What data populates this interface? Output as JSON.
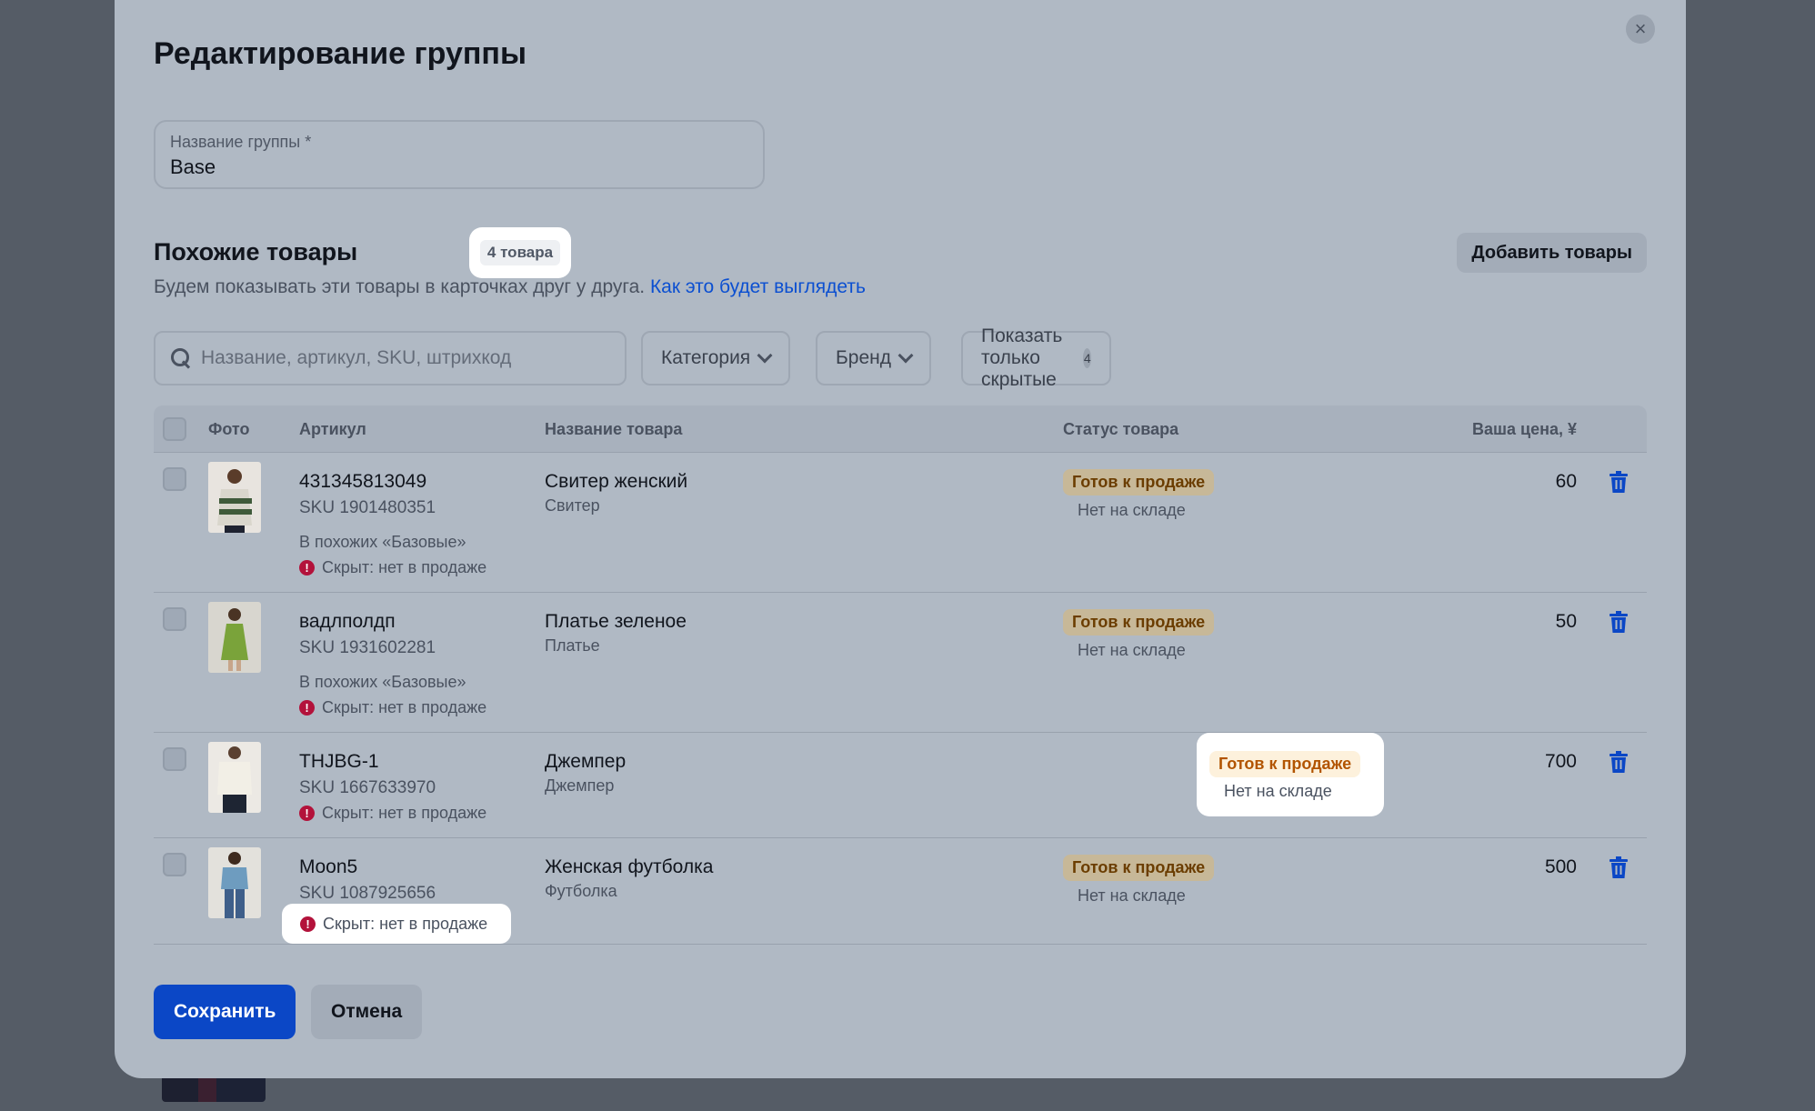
{
  "modal": {
    "title": "Редактирование группы",
    "close_icon": "close-icon",
    "name_field": {
      "label": "Название группы *",
      "value": "Base"
    },
    "similar": {
      "title": "Похожие товары",
      "count_badge": "4 товара",
      "description": "Будем показывать эти товары в карточках друг у друга.",
      "link": "Как это будет выглядеть",
      "add_button": "Добавить товары"
    },
    "filters": {
      "search_placeholder": "Название, артикул, SKU, штрихкод",
      "category": "Категория",
      "brand": "Бренд",
      "hidden_only": "Показать только скрытые",
      "hidden_count": "4"
    },
    "table": {
      "headers": {
        "photo": "Фото",
        "article": "Артикул",
        "name": "Название товара",
        "status": "Статус товара",
        "price": "Ваша цена, ¥"
      },
      "rows": [
        {
          "article": "431345813049",
          "sku": "SKU 1901480351",
          "in_similar": "В похожих «Базовые»",
          "hidden": "Скрыт: нет в продаже",
          "name": "Свитер женский",
          "category": "Свитер",
          "status": "Готов к продаже",
          "stock": "Нет на складе",
          "price": "60"
        },
        {
          "article": "вадлполдп",
          "sku": "SKU 1931602281",
          "in_similar": "В похожих «Базовые»",
          "hidden": "Скрыт: нет в продаже",
          "name": "Платье зеленое",
          "category": "Платье",
          "status": "Готов к продаже",
          "stock": "Нет на складе",
          "price": "50"
        },
        {
          "article": "THJBG-1",
          "sku": "SKU 1667633970",
          "hidden": "Скрыт: нет в продаже",
          "name": "Джемпер",
          "category": "Джемпер",
          "status": "Готов к продаже",
          "stock": "Нет на складе",
          "price": "700"
        },
        {
          "article": "Moon5",
          "sku": "SKU 1087925656",
          "hidden": "Скрыт: нет в продаже",
          "name": "Женская футболка",
          "category": "Футболка",
          "status": "Готов к продаже",
          "stock": "Нет на складе",
          "price": "500"
        }
      ]
    },
    "buttons": {
      "save": "Сохранить",
      "cancel": "Отмена"
    },
    "colors": {
      "primary": "#0b47c6",
      "link": "#0b4fd1",
      "warning": "#b3123b",
      "status_text": "#b25400"
    }
  }
}
